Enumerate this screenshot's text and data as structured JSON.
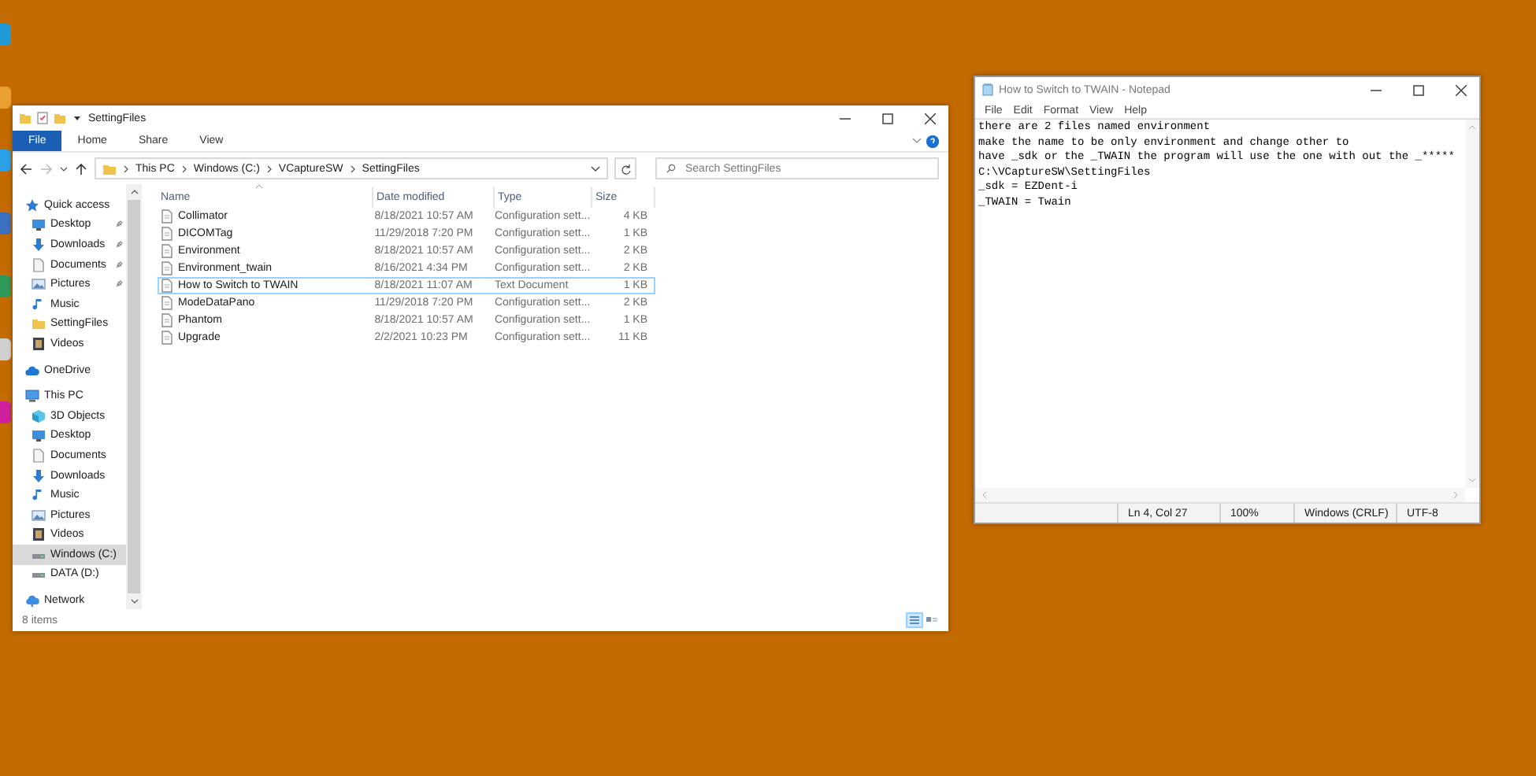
{
  "explorer": {
    "title": "SettingFiles",
    "ribbon_tabs": [
      {
        "label": "File",
        "selected": true
      },
      {
        "label": "Home",
        "selected": false
      },
      {
        "label": "Share",
        "selected": false
      },
      {
        "label": "View",
        "selected": false
      }
    ],
    "breadcrumb": [
      "This PC",
      "Windows (C:)",
      "VCaptureSW",
      "SettingFiles"
    ],
    "search": {
      "placeholder": "Search SettingFiles"
    },
    "nav": [
      {
        "label": "Quick access",
        "kind": "star",
        "selected": false,
        "children": [
          {
            "label": "Desktop",
            "kind": "desktop",
            "pinned": true,
            "selected": false
          },
          {
            "label": "Downloads",
            "kind": "download",
            "pinned": true,
            "selected": false
          },
          {
            "label": "Documents",
            "kind": "document",
            "pinned": true,
            "selected": false
          },
          {
            "label": "Pictures",
            "kind": "picture",
            "pinned": true,
            "selected": false
          },
          {
            "label": "Music",
            "kind": "music",
            "pinned": false,
            "selected": false
          },
          {
            "label": "SettingFiles",
            "kind": "folder",
            "pinned": false,
            "selected": false
          },
          {
            "label": "Videos",
            "kind": "video",
            "pinned": false,
            "selected": false
          }
        ]
      },
      {
        "label": "OneDrive",
        "kind": "cloud",
        "selected": false
      },
      {
        "label": "This PC",
        "kind": "pc",
        "selected": false,
        "children": [
          {
            "label": "3D Objects",
            "kind": "cube",
            "pinned": false,
            "selected": false
          },
          {
            "label": "Desktop",
            "kind": "desktop",
            "pinned": false,
            "selected": false
          },
          {
            "label": "Documents",
            "kind": "document",
            "pinned": false,
            "selected": false
          },
          {
            "label": "Downloads",
            "kind": "download",
            "pinned": false,
            "selected": false
          },
          {
            "label": "Music",
            "kind": "music",
            "pinned": false,
            "selected": false
          },
          {
            "label": "Pictures",
            "kind": "picture",
            "pinned": false,
            "selected": false
          },
          {
            "label": "Videos",
            "kind": "video",
            "pinned": false,
            "selected": false
          },
          {
            "label": "Windows (C:)",
            "kind": "drive",
            "pinned": false,
            "selected": true
          },
          {
            "label": "DATA (D:)",
            "kind": "drive",
            "pinned": false,
            "selected": false
          }
        ]
      },
      {
        "label": "Network",
        "kind": "network",
        "selected": false
      }
    ],
    "columns": [
      "Name",
      "Date modified",
      "Type",
      "Size"
    ],
    "files": [
      {
        "name": "Collimator",
        "date": "8/18/2021 10:57 AM",
        "type": "Configuration sett...",
        "size": "4 KB",
        "selected": false
      },
      {
        "name": "DICOMTag",
        "date": "11/29/2018 7:20 PM",
        "type": "Configuration sett...",
        "size": "1 KB",
        "selected": false
      },
      {
        "name": "Environment",
        "date": "8/18/2021 10:57 AM",
        "type": "Configuration sett...",
        "size": "2 KB",
        "selected": false
      },
      {
        "name": "Environment_twain",
        "date": "8/16/2021 4:34 PM",
        "type": "Configuration sett...",
        "size": "2 KB",
        "selected": false
      },
      {
        "name": "How to Switch to TWAIN",
        "date": "8/18/2021 11:07 AM",
        "type": "Text Document",
        "size": "1 KB",
        "selected": true
      },
      {
        "name": "ModeDataPano",
        "date": "11/29/2018 7:20 PM",
        "type": "Configuration sett...",
        "size": "2 KB",
        "selected": false
      },
      {
        "name": "Phantom",
        "date": "8/18/2021 10:57 AM",
        "type": "Configuration sett...",
        "size": "1 KB",
        "selected": false
      },
      {
        "name": "Upgrade",
        "date": "2/2/2021 10:23 PM",
        "type": "Configuration sett...",
        "size": "11 KB",
        "selected": false
      }
    ],
    "status": "8 items"
  },
  "notepad": {
    "title": "How to Switch to TWAIN - Notepad",
    "menu": [
      "File",
      "Edit",
      "Format",
      "View",
      "Help"
    ],
    "lines": [
      "there are 2 files named environment",
      "make the name to be only environment and change other to",
      "have _sdk or the _TWAIN the program will use the one with out the _*****",
      "C:\\VCaptureSW\\SettingFiles",
      "_sdk = EZDent-i",
      "_TWAIN = Twain"
    ],
    "status": [
      "Ln 4, Col 27",
      "100%",
      "Windows (CRLF)",
      "UTF-8"
    ]
  }
}
